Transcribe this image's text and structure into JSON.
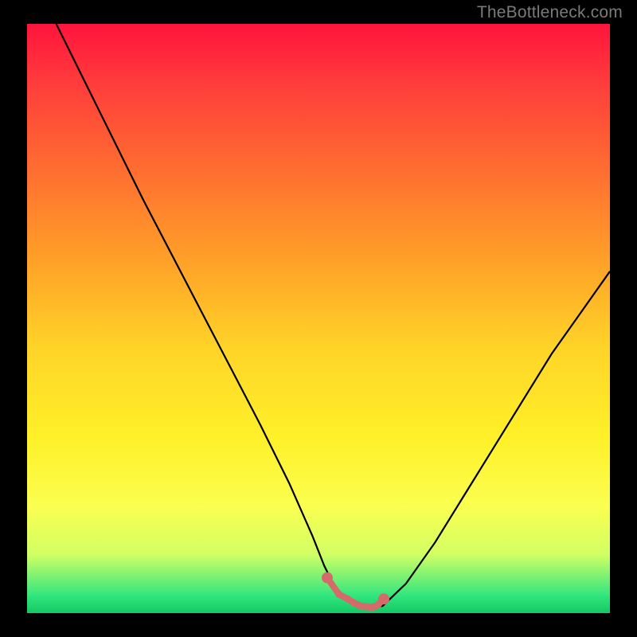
{
  "watermark": "TheBottleneck.com",
  "colors": {
    "background": "#000000",
    "curve_stroke": "#000000",
    "marker_fill": "#d46a6a",
    "marker_stroke": "#d46a6a",
    "gradient_top": "#ff143c",
    "gradient_bottom": "#14c864",
    "watermark_text": "#7a7a7a"
  },
  "chart_data": {
    "type": "line",
    "title": "",
    "xlabel": "",
    "ylabel": "",
    "xlim": [
      0,
      100
    ],
    "ylim": [
      0,
      100
    ],
    "grid": false,
    "legend": false,
    "series": [
      {
        "name": "curve",
        "x": [
          5,
          10,
          15,
          20,
          25,
          30,
          35,
          40,
          45,
          49,
          51,
          53,
          56,
          58,
          59.5,
          61,
          65,
          70,
          75,
          80,
          85,
          90,
          95,
          100
        ],
        "y": [
          100,
          90,
          80,
          70,
          60.5,
          51,
          41.5,
          32,
          22,
          13,
          8,
          4,
          1.5,
          1,
          1,
          1.2,
          5,
          12,
          20,
          28,
          36,
          44,
          51,
          58
        ]
      },
      {
        "name": "markers",
        "x": [
          51.5,
          53.5,
          55,
          56,
          57,
          58,
          58.8,
          59.3,
          59.8,
          60.3,
          61.2
        ],
        "y": [
          6,
          3.2,
          2.4,
          1.8,
          1.3,
          1.1,
          1.0,
          1.0,
          1.2,
          1.5,
          2.4
        ]
      }
    ]
  }
}
